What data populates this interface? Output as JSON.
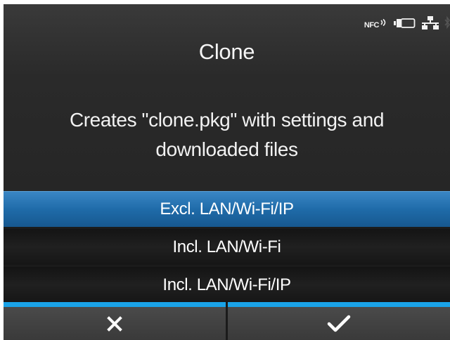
{
  "header": {
    "title": "Clone",
    "status_icons": [
      "nfc-icon",
      "battery-icon",
      "network-icon",
      "bluetooth-icon"
    ],
    "nfc_label": "NFC"
  },
  "message": {
    "line1": "Creates \"clone.pkg\" with settings and",
    "line2": "downloaded files"
  },
  "options": [
    {
      "label": "Excl. LAN/Wi-Fi/IP",
      "selected": true
    },
    {
      "label": "Incl. LAN/Wi-Fi",
      "selected": false
    },
    {
      "label": "Incl. LAN/Wi-Fi/IP",
      "selected": false
    }
  ],
  "footer": {
    "cancel_icon": "close-icon",
    "confirm_icon": "checkmark-icon"
  },
  "colors": {
    "accent": "#1aa3e8",
    "selected_row": "#1f6ba9",
    "background": "#1b1b1b"
  }
}
